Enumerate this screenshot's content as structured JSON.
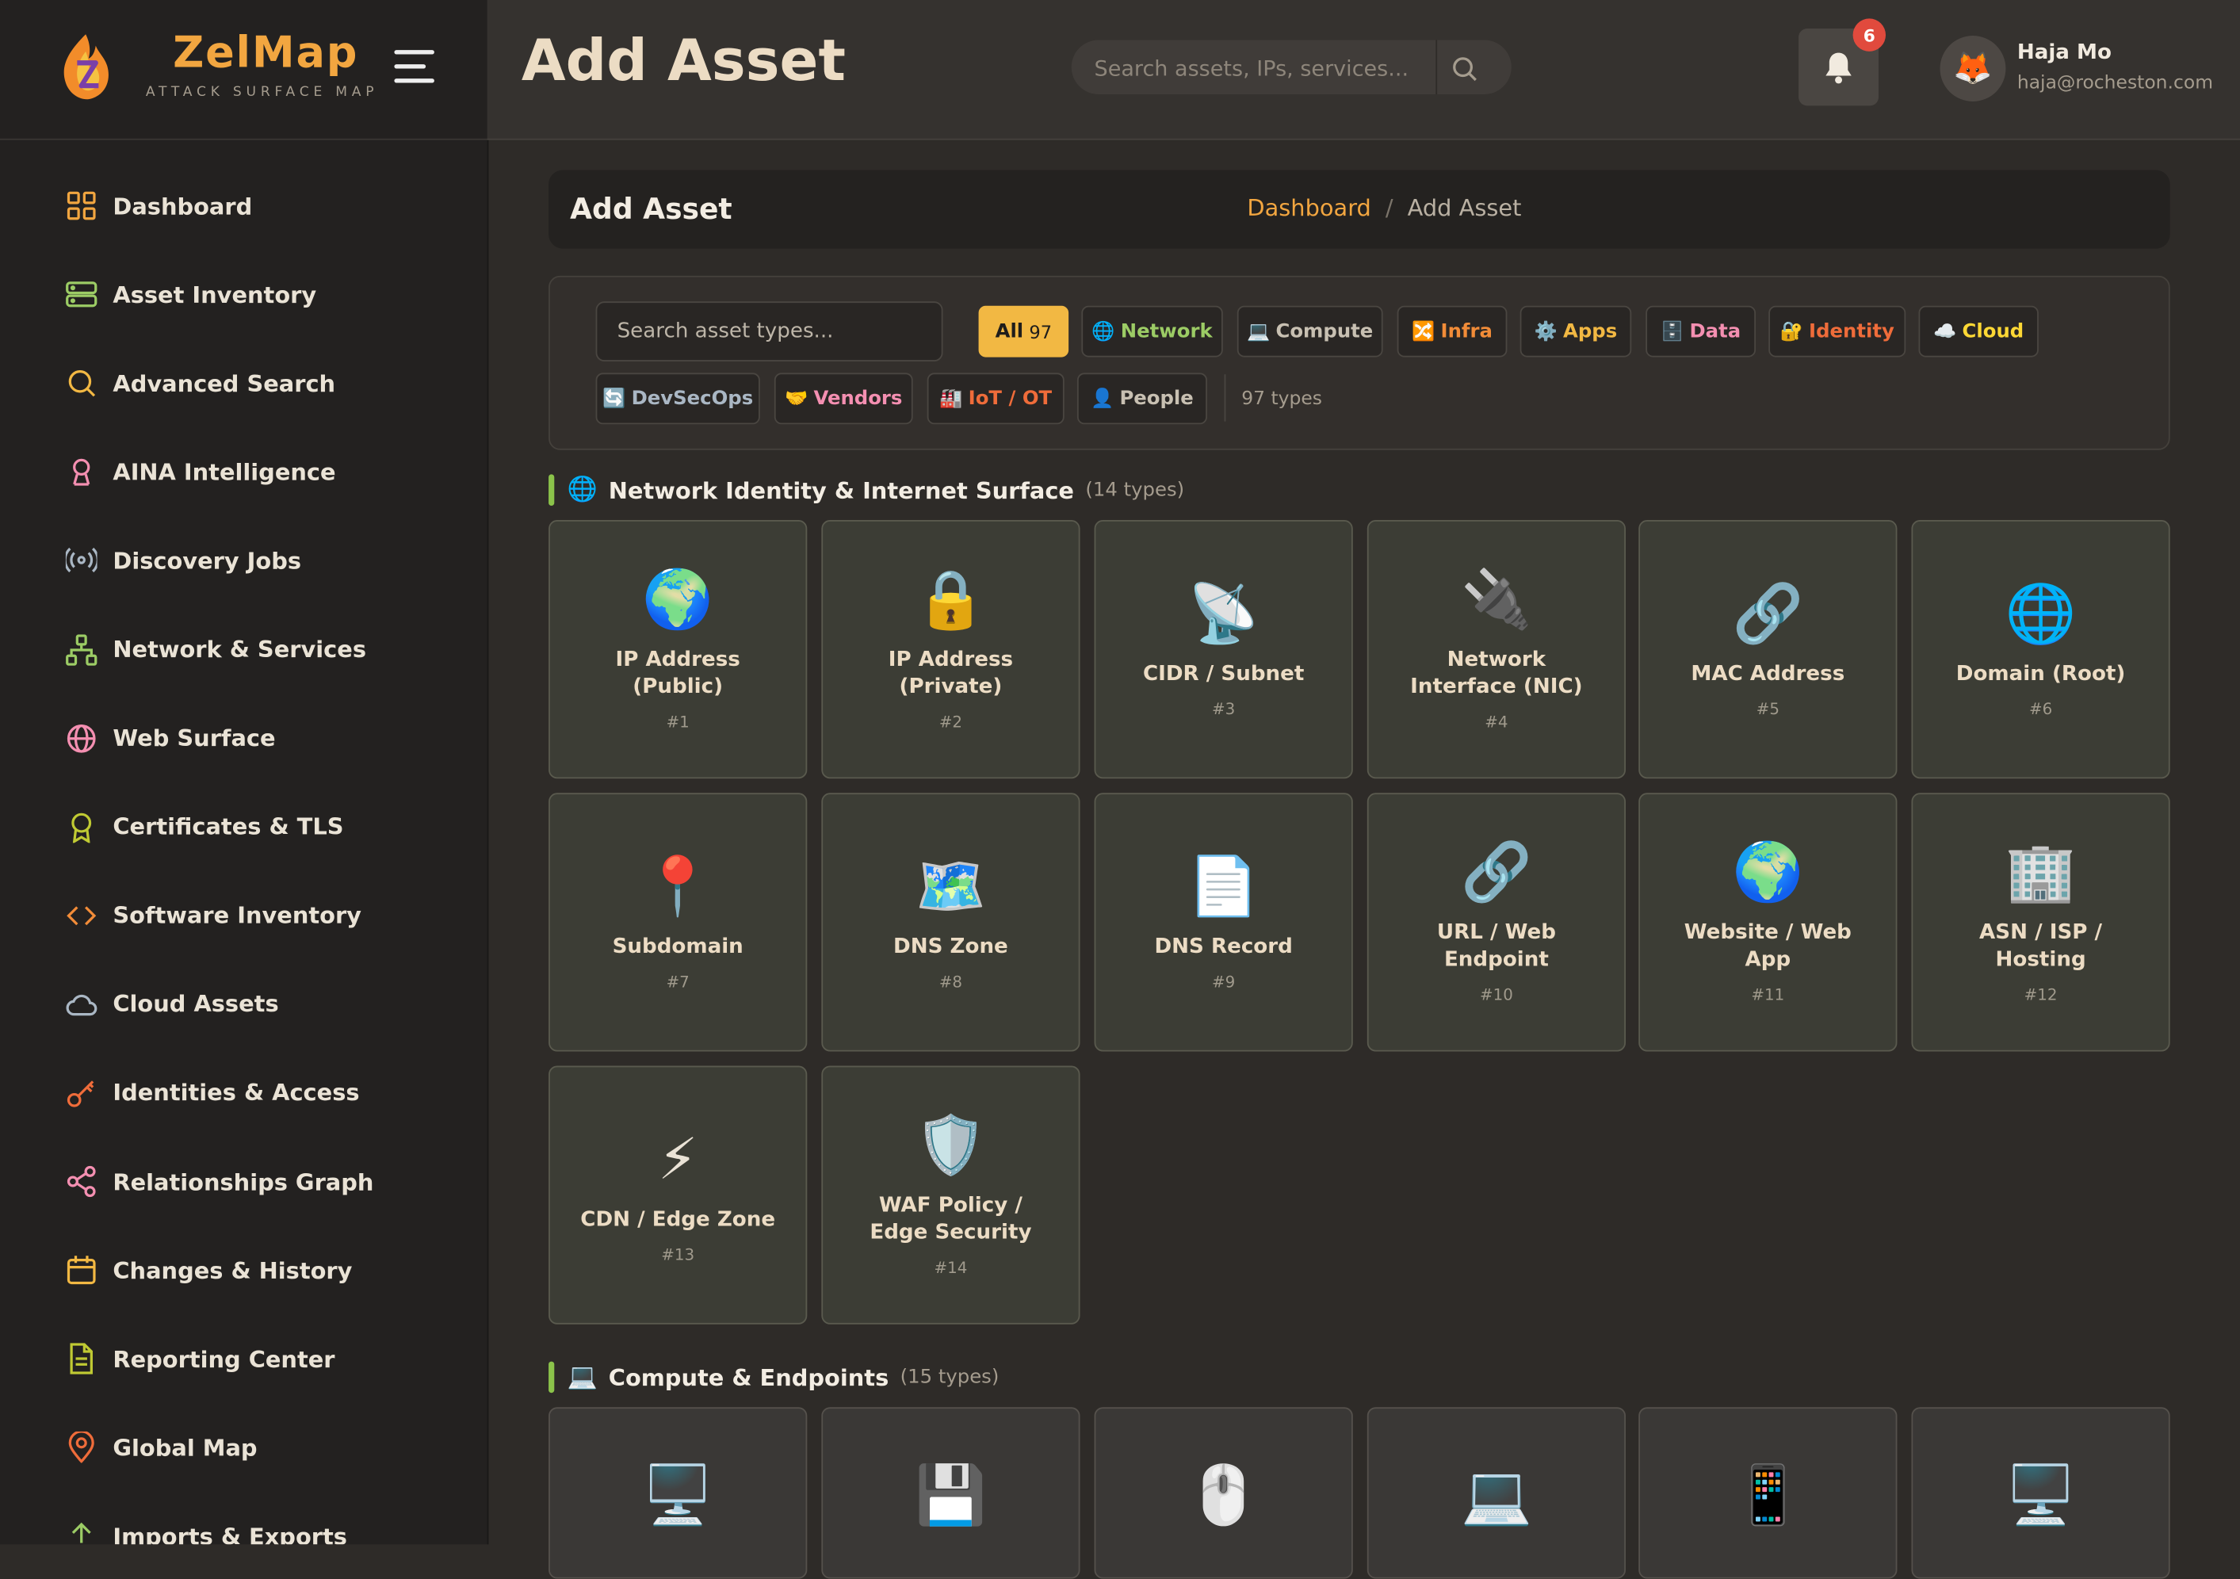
{
  "brand": {
    "name": "ZelMap",
    "subtitle": "ATTACK SURFACE MAP"
  },
  "sidebar": {
    "items": [
      {
        "label": "Dashboard",
        "icon": "grid-icon"
      },
      {
        "label": "Asset Inventory",
        "icon": "server-icon"
      },
      {
        "label": "Advanced Search",
        "icon": "search-icon"
      },
      {
        "label": "AINA Intelligence",
        "icon": "brain-icon"
      },
      {
        "label": "Discovery Jobs",
        "icon": "radar-icon"
      },
      {
        "label": "Network & Services",
        "icon": "network-icon"
      },
      {
        "label": "Web Surface",
        "icon": "globe-icon"
      },
      {
        "label": "Certificates & TLS",
        "icon": "award-icon"
      },
      {
        "label": "Software Inventory",
        "icon": "code-icon"
      },
      {
        "label": "Cloud Assets",
        "icon": "cloud-icon"
      },
      {
        "label": "Identities & Access",
        "icon": "key-icon"
      },
      {
        "label": "Relationships Graph",
        "icon": "share-icon"
      },
      {
        "label": "Changes & History",
        "icon": "calendar-icon"
      },
      {
        "label": "Reporting Center",
        "icon": "document-icon"
      },
      {
        "label": "Global Map",
        "icon": "map-pin-icon"
      },
      {
        "label": "Imports & Exports",
        "icon": "upload-icon"
      }
    ]
  },
  "header": {
    "title": "Add Asset",
    "search_placeholder": "Search assets, IPs, services...",
    "notification_count": "6",
    "user_name": "Haja Mo",
    "user_email": "haja@rocheston.com",
    "avatar_glyph": "🦊"
  },
  "breadcrumb": {
    "title": "Add Asset",
    "home": "Dashboard",
    "separator": "/",
    "current": "Add Asset"
  },
  "filters": {
    "search_placeholder": "Search asset types...",
    "chips": [
      {
        "label": "All",
        "count": "97",
        "icon": "",
        "color": "#1f1d1b",
        "active": true
      },
      {
        "label": "Network",
        "icon": "🌐",
        "color": "#9ccc65"
      },
      {
        "label": "Compute",
        "icon": "💻",
        "color": "#c8c0b2"
      },
      {
        "label": "Infra",
        "icon": "🔀",
        "color": "#f28c38"
      },
      {
        "label": "Apps",
        "icon": "⚙️",
        "color": "#f2b843"
      },
      {
        "label": "Data",
        "icon": "🗄️",
        "color": "#f48fb1"
      },
      {
        "label": "Identity",
        "icon": "🔐",
        "color": "#ef6c3a"
      },
      {
        "label": "Cloud",
        "icon": "☁️",
        "color": "#fdd835"
      },
      {
        "label": "DevSecOps",
        "icon": "🔄",
        "color": "#aab7c4"
      },
      {
        "label": "Vendors",
        "icon": "🤝",
        "color": "#f48fb1"
      },
      {
        "label": "IoT / OT",
        "icon": "🏭",
        "color": "#ef6c3a"
      },
      {
        "label": "People",
        "icon": "👤",
        "color": "#c8c0b2"
      }
    ],
    "types_count": "97 types"
  },
  "sections": [
    {
      "icon": "🌐",
      "title": "Network Identity & Internet Surface",
      "count": "(14 types)",
      "items": [
        {
          "icon": "🌍",
          "name": "IP Address (Public)",
          "num": "#1"
        },
        {
          "icon": "🔒",
          "name": "IP Address (Private)",
          "num": "#2"
        },
        {
          "icon": "📡",
          "name": "CIDR / Subnet",
          "num": "#3"
        },
        {
          "icon": "🔌",
          "name": "Network Interface (NIC)",
          "num": "#4"
        },
        {
          "icon": "🔗",
          "name": "MAC Address",
          "num": "#5"
        },
        {
          "icon": "🌐",
          "name": "Domain (Root)",
          "num": "#6"
        },
        {
          "icon": "📍",
          "name": "Subdomain",
          "num": "#7"
        },
        {
          "icon": "🗺️",
          "name": "DNS Zone",
          "num": "#8"
        },
        {
          "icon": "📄",
          "name": "DNS Record",
          "num": "#9"
        },
        {
          "icon": "🔗",
          "name": "URL / Web Endpoint",
          "num": "#10"
        },
        {
          "icon": "🌍",
          "name": "Website / Web App",
          "num": "#11"
        },
        {
          "icon": "🏢",
          "name": "ASN / ISP / Hosting",
          "num": "#12"
        },
        {
          "icon": "⚡",
          "name": "CDN / Edge Zone",
          "num": "#13"
        },
        {
          "icon": "🛡️",
          "name": "WAF Policy / Edge Security",
          "num": "#14"
        }
      ]
    },
    {
      "icon": "💻",
      "title": "Compute & Endpoints",
      "count": "(15 types)",
      "items": [
        {
          "icon": "🖥️"
        },
        {
          "icon": "💾"
        },
        {
          "icon": "🖱️"
        },
        {
          "icon": "💻"
        },
        {
          "icon": "📱"
        },
        {
          "icon": "🖥️"
        }
      ]
    }
  ],
  "colors": {
    "accent": "#f2a640",
    "section_bar": "#8bc34a",
    "badge": "#e14a3d"
  }
}
